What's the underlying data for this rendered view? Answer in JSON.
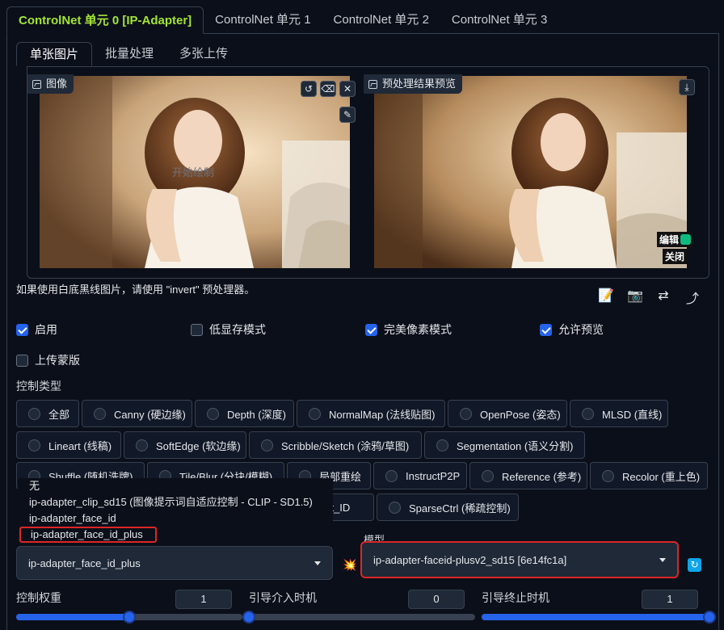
{
  "unit_tabs": [
    "ControlNet 单元 0 [IP-Adapter]",
    "ControlNet 单元 1",
    "ControlNet 单元 2",
    "ControlNet 单元 3"
  ],
  "mode_tabs": [
    "单张图片",
    "批量处理",
    "多张上传"
  ],
  "image_panel": {
    "label": "图像",
    "draw_hint": "开始绘制",
    "tools": [
      "↺",
      "⌫",
      "✕"
    ],
    "brush": "✎"
  },
  "preview_panel": {
    "label": "预处理结果预览",
    "download": "⤓",
    "edit_label": "编辑",
    "close_label": "关闭"
  },
  "hint_text": "如果使用白底黑线图片，请使用 \"invert\" 预处理器。",
  "util_icons": [
    "📝",
    "📷",
    "⇄",
    "⤴"
  ],
  "checkboxes": {
    "enable": {
      "label": "启用",
      "checked": true
    },
    "low_vram": {
      "label": "低显存模式",
      "checked": false
    },
    "pixel_perfect": {
      "label": "完美像素模式",
      "checked": true
    },
    "allow_preview": {
      "label": "允许预览",
      "checked": true
    },
    "upload_mask": {
      "label": "上传蒙版",
      "checked": false
    }
  },
  "control_type_label": "控制类型",
  "control_types_row1": [
    "全部",
    "Canny (硬边缘)",
    "Depth (深度)",
    "NormalMap (法线贴图)",
    "OpenPose (姿态)",
    "MLSD (直线)"
  ],
  "control_types_row2": [
    "Lineart (线稿)",
    "SoftEdge (软边缘)",
    "Scribble/Sketch (涂鸦/草图)",
    "Segmentation (语义分割)"
  ],
  "control_types_row3": [
    "Shuffle (随机洗牌)",
    "Tile/Blur (分块/模糊)",
    "局部重绘",
    "InstructP2P",
    "Reference (参考)",
    "Recolor (重上色)"
  ],
  "control_types_row4": [
    "ant_ID",
    "SparseCtrl (稀疏控制)"
  ],
  "preprocessor_options": [
    "无",
    "ip-adapter_clip_sd15 (图像提示词自适应控制 - CLIP - SD1.5)",
    "ip-adapter_face_id",
    "ip-adapter_face_id_plus"
  ],
  "preprocessor_selected": "ip-adapter_face_id_plus",
  "model_label": "模型",
  "model_selected": "ip-adapter-faceid-plusv2_sd15 [6e14fc1a]",
  "sliders": {
    "weight": {
      "label": "控制权重",
      "value": "1",
      "fraction": 0.5
    },
    "start": {
      "label": "引导介入时机",
      "value": "0",
      "fraction": 0.0
    },
    "end": {
      "label": "引导终止时机",
      "value": "1",
      "fraction": 1.0
    }
  },
  "colors": {
    "accent_green": "#a3e635",
    "checkbox_blue": "#2563eb",
    "highlight_red": "#dc2626"
  }
}
